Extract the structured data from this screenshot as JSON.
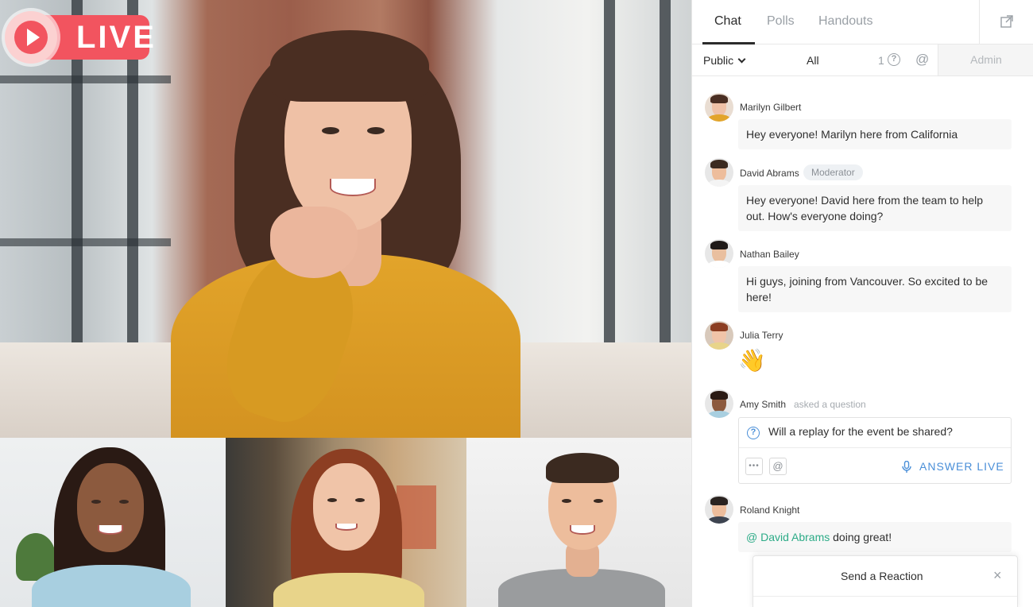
{
  "live_badge": {
    "label": "LIVE"
  },
  "tabs": [
    {
      "label": "Chat",
      "active": true
    },
    {
      "label": "Polls",
      "active": false
    },
    {
      "label": "Handouts",
      "active": false
    }
  ],
  "popout_icon": "external-link-icon",
  "filters": {
    "visibility": "Public",
    "all": "All",
    "questions_count": "1",
    "questions_icon": "question-icon",
    "mentions_icon": "at-icon",
    "admin": "Admin"
  },
  "messages": [
    {
      "author": "Marilyn Gilbert",
      "text": "Hey everyone! Marilyn here from California"
    },
    {
      "author": "David Abrams",
      "badge": "Moderator",
      "text": "Hey everyone! David here from the team to help out. How's everyone doing?"
    },
    {
      "author": "Nathan Bailey",
      "text": "Hi guys, joining from Vancouver. So excited to be here!"
    },
    {
      "author": "Julia Terry",
      "emoji": "👋"
    },
    {
      "author": "Amy Smith",
      "note": "asked a question",
      "question": "Will a replay for the event be shared?",
      "answer_label": "ANSWER LIVE"
    },
    {
      "author": "Roland Knight",
      "mention": "@ David Abrams",
      "text": " doing great!"
    }
  ],
  "reaction_panel": {
    "title": "Send a Reaction",
    "close": "×"
  },
  "colors": {
    "live": "#f2545f",
    "link": "#4a8fd8",
    "mention": "#2cab87"
  }
}
